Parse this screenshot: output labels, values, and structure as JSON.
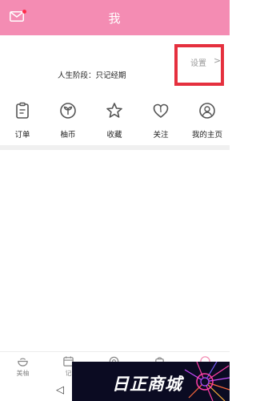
{
  "header": {
    "title": "我",
    "mail_icon": "mail-icon",
    "color": "#f48cb3"
  },
  "profile": {
    "stage_text": "人生阶段：只记经期",
    "settings_label": "设置",
    "settings_chevron": ">"
  },
  "menu": {
    "items": [
      {
        "label": "订单",
        "icon": "clipboard-icon"
      },
      {
        "label": "柚币",
        "icon": "sprout-coin-icon"
      },
      {
        "label": "收藏",
        "icon": "star-icon"
      },
      {
        "label": "关注",
        "icon": "heart-icon"
      },
      {
        "label": "我的主页",
        "icon": "user-icon"
      }
    ]
  },
  "tabbar": {
    "items": [
      {
        "label": "美柚",
        "icon": "bowl-icon"
      },
      {
        "label": "记",
        "icon": "calendar-icon"
      },
      {
        "label": "",
        "icon": "circle-icon"
      },
      {
        "label": "",
        "icon": "bag-icon"
      },
      {
        "label": "",
        "icon": "profile-icon",
        "active": true
      }
    ]
  },
  "watermark": {
    "text": "日正商城"
  }
}
